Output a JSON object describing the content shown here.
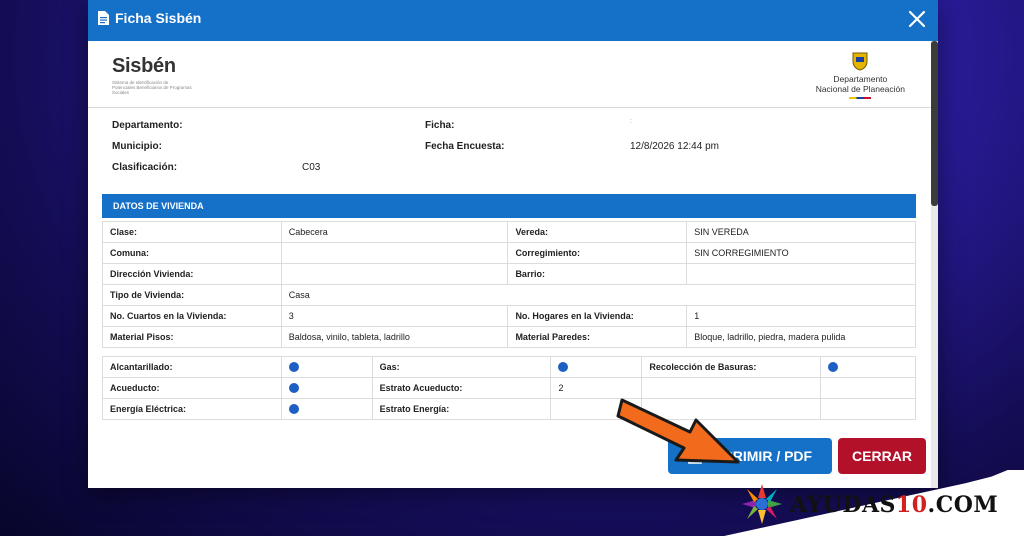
{
  "modal": {
    "title": "Ficha Sisbén",
    "logo_left": "Sisbén",
    "logo_left_sub": "Sistema de Identificación de Potenciales Beneficiarios de Programas Sociales",
    "logo_right_line1": "Departamento",
    "logo_right_line2": "Nacional de Planeación"
  },
  "info": {
    "departamento_label": "Departamento:",
    "municipio_label": "Municipio:",
    "clasificacion_label": "Clasificación:",
    "clasificacion_value": "C03",
    "ficha_label": "Ficha:",
    "ficha_value": ":",
    "fecha_label": "Fecha Encuesta:",
    "fecha_value": "12/8/2026 12:44 pm"
  },
  "vivienda": {
    "section_title": "DATOS DE VIVIENDA",
    "rows": [
      [
        "Clase:",
        "Cabecera",
        "Vereda:",
        "SIN VEREDA"
      ],
      [
        "Comuna:",
        "",
        "Corregimiento:",
        "SIN CORREGIMIENTO"
      ],
      [
        "Dirección Vivienda:",
        "",
        "Barrio:",
        ""
      ],
      [
        "Tipo de Vivienda:",
        "Casa",
        "",
        ""
      ],
      [
        "No. Cuartos en la Vivienda:",
        "3",
        "No. Hogares en la Vivienda:",
        "1"
      ],
      [
        "Material Pisos:",
        "Baldosa, vinilo, tableta, ladrillo",
        "Material Paredes:",
        "Bloque, ladrillo, piedra, madera pulida"
      ]
    ]
  },
  "servicios": {
    "alcantarillado": "Alcantarillado:",
    "gas": "Gas:",
    "recoleccion": "Recolección de Basuras:",
    "acueducto": "Acueducto:",
    "estrato_acueducto": "Estrato Acueducto:",
    "estrato_acueducto_value": "2",
    "energia": "Energía Eléctrica:",
    "estrato_energia": "Estrato Energía:"
  },
  "buttons": {
    "print": "IMPRIMIR / PDF",
    "close": "CERRAR"
  },
  "watermark": {
    "brand_a": "AYUDAS",
    "brand_b": "10",
    "brand_c": ".COM"
  },
  "colors": {
    "primary": "#1570c7",
    "danger": "#b3102a",
    "dot": "#1d5fc2",
    "arrow": "#f26a1b"
  }
}
